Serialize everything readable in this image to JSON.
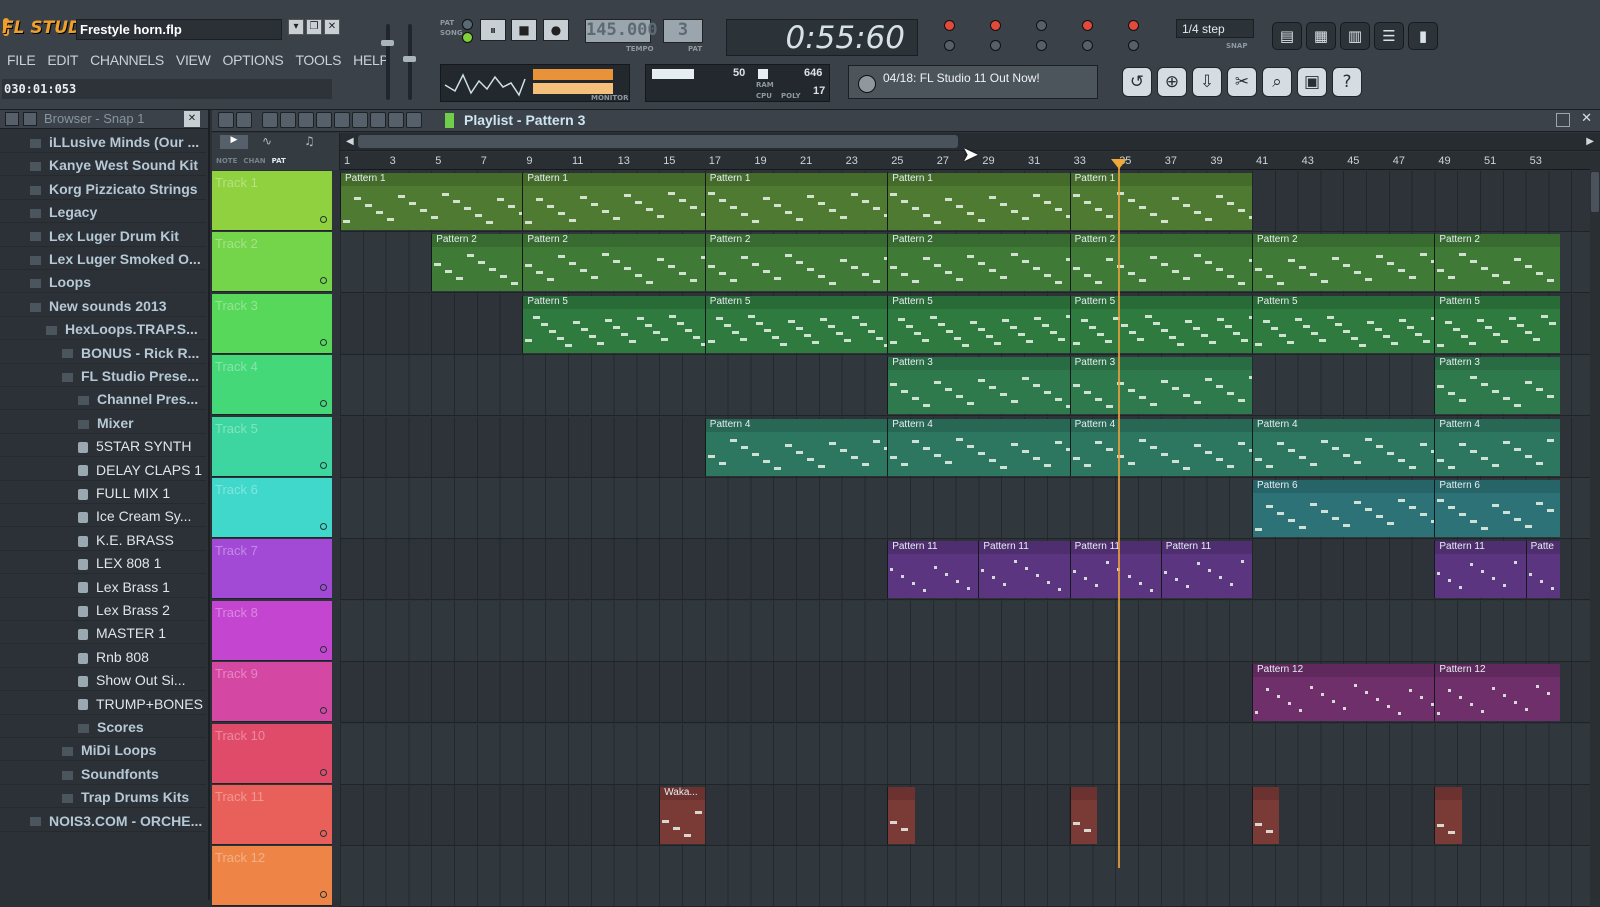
{
  "app": {
    "logo": "FL STUDIO",
    "project": "Frestyle horn.flp",
    "win_min": "▾",
    "win_max": "❐",
    "win_close": "✕"
  },
  "menu": [
    "FILE",
    "EDIT",
    "CHANNELS",
    "VIEW",
    "OPTIONS",
    "TOOLS",
    "HELP"
  ],
  "time_readout": "030:01:053",
  "transport": {
    "mode_pat": "PAT",
    "mode_song": "SONG",
    "pause": "⏸",
    "stop": "■",
    "record": "●",
    "tempo": "145.000",
    "tempo_label": "TEMPO",
    "pattern_num": "3",
    "pattern_label": "PAT",
    "clock": "0:55:60",
    "snap": "1/4 step",
    "snap_label": "SNAP"
  },
  "meters": {
    "ram": "50",
    "ram_label": "RAM",
    "cpu_label": "CPU",
    "poly": "646",
    "poly_label": "POLY",
    "voices": "17",
    "monitor": "MONITOR"
  },
  "hint": "04/18: FL Studio 11 Out Now!",
  "browser": {
    "title": "Browser - Snap 1",
    "items": [
      {
        "label": "iLLusive Minds (Our ...",
        "kind": "folder",
        "level": 0
      },
      {
        "label": "Kanye West Sound Kit",
        "kind": "folder",
        "level": 0
      },
      {
        "label": "Korg Pizzicato Strings",
        "kind": "folder",
        "level": 0
      },
      {
        "label": "Legacy",
        "kind": "folder",
        "level": 0
      },
      {
        "label": "Lex Luger Drum Kit",
        "kind": "folder",
        "level": 0
      },
      {
        "label": "Lex Luger Smoked O...",
        "kind": "folder",
        "level": 0
      },
      {
        "label": "Loops",
        "kind": "folder",
        "level": 0
      },
      {
        "label": "New sounds 2013",
        "kind": "folder",
        "level": 0
      },
      {
        "label": "HexLoops.TRAP.S...",
        "kind": "folder",
        "level": 1
      },
      {
        "label": "BONUS - Rick R...",
        "kind": "folder",
        "level": 2
      },
      {
        "label": "FL Studio Prese...",
        "kind": "folder",
        "level": 2
      },
      {
        "label": "Channel Pres...",
        "kind": "folder",
        "level": 3
      },
      {
        "label": "Mixer",
        "kind": "folder",
        "level": 3
      },
      {
        "label": "5STAR SYNTH",
        "kind": "file",
        "level": 3
      },
      {
        "label": "DELAY CLAPS 1",
        "kind": "file",
        "level": 3
      },
      {
        "label": "FULL MIX 1",
        "kind": "file",
        "level": 3
      },
      {
        "label": "Ice Cream Sy...",
        "kind": "file",
        "level": 3
      },
      {
        "label": "K.E. BRASS",
        "kind": "file",
        "level": 3
      },
      {
        "label": "LEX 808 1",
        "kind": "file",
        "level": 3
      },
      {
        "label": "Lex Brass 1",
        "kind": "file",
        "level": 3
      },
      {
        "label": "Lex Brass 2",
        "kind": "file",
        "level": 3
      },
      {
        "label": "MASTER 1",
        "kind": "file",
        "level": 3
      },
      {
        "label": "Rnb 808",
        "kind": "file",
        "level": 3
      },
      {
        "label": "Show Out Si...",
        "kind": "file",
        "level": 3
      },
      {
        "label": "TRUMP+BONES",
        "kind": "file",
        "level": 3
      },
      {
        "label": "Scores",
        "kind": "folder",
        "level": 3
      },
      {
        "label": "MiDi Loops",
        "kind": "folder",
        "level": 2
      },
      {
        "label": "Soundfonts",
        "kind": "folder",
        "level": 2
      },
      {
        "label": "Trap Drums Kits",
        "kind": "folder",
        "level": 2
      },
      {
        "label": "NOIS3.COM - ORCHE...",
        "kind": "folder",
        "level": 0
      }
    ]
  },
  "playlist": {
    "title": "Playlist - Pattern 3",
    "tool_labels": [
      "NOTE",
      "CHAN",
      "PAT"
    ],
    "bars": [
      "1",
      "3",
      "5",
      "7",
      "9",
      "11",
      "13",
      "15",
      "17",
      "19",
      "21",
      "23",
      "25",
      "27",
      "29",
      "31",
      "33",
      "35",
      "37",
      "39",
      "41",
      "43",
      "45",
      "47",
      "49",
      "51",
      "53"
    ],
    "tracks": [
      {
        "name": "Track 1",
        "color": "#8fd13f"
      },
      {
        "name": "Track 2",
        "color": "#74d44a"
      },
      {
        "name": "Track 3",
        "color": "#57d85a"
      },
      {
        "name": "Track 4",
        "color": "#45d879"
      },
      {
        "name": "Track 5",
        "color": "#3ed6a0"
      },
      {
        "name": "Track 6",
        "color": "#3fd8cb"
      },
      {
        "name": "Track 7",
        "color": "#a24ad6"
      },
      {
        "name": "Track 8",
        "color": "#c446d0"
      },
      {
        "name": "Track 9",
        "color": "#d447a2"
      },
      {
        "name": "Track 10",
        "color": "#e04b6a"
      },
      {
        "name": "Track 11",
        "color": "#e9605a"
      },
      {
        "name": "Track 12",
        "color": "#ef8447"
      }
    ],
    "clips": [
      {
        "track": 0,
        "label": "Pattern 1",
        "start": 1,
        "end": 9,
        "color": "#4f7a32"
      },
      {
        "track": 0,
        "label": "Pattern 1",
        "start": 9,
        "end": 17,
        "color": "#4f7a32"
      },
      {
        "track": 0,
        "label": "Pattern 1",
        "start": 17,
        "end": 25,
        "color": "#4f7a32"
      },
      {
        "track": 0,
        "label": "Pattern 1",
        "start": 25,
        "end": 33,
        "color": "#4f7a32"
      },
      {
        "track": 0,
        "label": "Pattern 1",
        "start": 33,
        "end": 41,
        "color": "#4f7a32"
      },
      {
        "track": 1,
        "label": "Pattern 2",
        "start": 5,
        "end": 9,
        "color": "#3f7a36"
      },
      {
        "track": 1,
        "label": "Pattern 2",
        "start": 9,
        "end": 17,
        "color": "#3f7a36"
      },
      {
        "track": 1,
        "label": "Pattern 2",
        "start": 17,
        "end": 25,
        "color": "#3f7a36"
      },
      {
        "track": 1,
        "label": "Pattern 2",
        "start": 25,
        "end": 33,
        "color": "#3f7a36"
      },
      {
        "track": 1,
        "label": "Pattern 2",
        "start": 33,
        "end": 41,
        "color": "#3f7a36"
      },
      {
        "track": 1,
        "label": "Pattern 2",
        "start": 41,
        "end": 49,
        "color": "#3f7a36"
      },
      {
        "track": 1,
        "label": "Pattern 2",
        "start": 49,
        "end": 54.5,
        "color": "#3f7a36"
      },
      {
        "track": 2,
        "label": "Pattern 5",
        "start": 9,
        "end": 17,
        "color": "#2f7a3f"
      },
      {
        "track": 2,
        "label": "Pattern 5",
        "start": 17,
        "end": 25,
        "color": "#2f7a3f"
      },
      {
        "track": 2,
        "label": "Pattern 5",
        "start": 25,
        "end": 33,
        "color": "#2f7a3f"
      },
      {
        "track": 2,
        "label": "Pattern 5",
        "start": 33,
        "end": 41,
        "color": "#2f7a3f"
      },
      {
        "track": 2,
        "label": "Pattern 5",
        "start": 41,
        "end": 49,
        "color": "#2f7a3f"
      },
      {
        "track": 2,
        "label": "Pattern 5",
        "start": 49,
        "end": 54.5,
        "color": "#2f7a3f"
      },
      {
        "track": 3,
        "label": "Pattern 3",
        "start": 25,
        "end": 33,
        "color": "#2f7a4c"
      },
      {
        "track": 3,
        "label": "Pattern 3",
        "start": 33,
        "end": 41,
        "color": "#2f7a4c"
      },
      {
        "track": 3,
        "label": "Pattern 3",
        "start": 49,
        "end": 54.5,
        "color": "#2f7a4c"
      },
      {
        "track": 4,
        "label": "Pattern 4",
        "start": 17,
        "end": 25,
        "color": "#2d7660"
      },
      {
        "track": 4,
        "label": "Pattern 4",
        "start": 25,
        "end": 33,
        "color": "#2d7660"
      },
      {
        "track": 4,
        "label": "Pattern 4",
        "start": 33,
        "end": 41,
        "color": "#2d7660"
      },
      {
        "track": 4,
        "label": "Pattern 4",
        "start": 41,
        "end": 49,
        "color": "#2d7660"
      },
      {
        "track": 4,
        "label": "Pattern 4",
        "start": 49,
        "end": 54.5,
        "color": "#2d7660"
      },
      {
        "track": 5,
        "label": "Pattern 6",
        "start": 41,
        "end": 49,
        "color": "#2d7276"
      },
      {
        "track": 5,
        "label": "Pattern 6",
        "start": 49,
        "end": 54.5,
        "color": "#2d7276"
      },
      {
        "track": 6,
        "label": "Pattern 11",
        "start": 25,
        "end": 29,
        "color": "#5b3580"
      },
      {
        "track": 6,
        "label": "Pattern 11",
        "start": 29,
        "end": 33,
        "color": "#5b3580"
      },
      {
        "track": 6,
        "label": "Pattern 11",
        "start": 33,
        "end": 37,
        "color": "#5b3580"
      },
      {
        "track": 6,
        "label": "Pattern 11",
        "start": 37,
        "end": 41,
        "color": "#5b3580"
      },
      {
        "track": 6,
        "label": "Pattern 11",
        "start": 49,
        "end": 53,
        "color": "#5b3580"
      },
      {
        "track": 6,
        "label": "Patte",
        "start": 53,
        "end": 54.5,
        "color": "#5b3580"
      },
      {
        "track": 8,
        "label": "Pattern 12",
        "start": 41,
        "end": 49,
        "color": "#6e2f6a"
      },
      {
        "track": 8,
        "label": "Pattern 12",
        "start": 49,
        "end": 54.5,
        "color": "#6e2f6a"
      },
      {
        "track": 10,
        "label": "Waka...",
        "start": 15,
        "end": 17,
        "color": "#7a3a36"
      },
      {
        "track": 10,
        "label": "",
        "start": 25,
        "end": 26.2,
        "color": "#7a3a36"
      },
      {
        "track": 10,
        "label": "",
        "start": 33,
        "end": 34.2,
        "color": "#7a3a36"
      },
      {
        "track": 10,
        "label": "",
        "start": 41,
        "end": 42.2,
        "color": "#7a3a36"
      },
      {
        "track": 10,
        "label": "",
        "start": 49,
        "end": 50.2,
        "color": "#7a3a36"
      }
    ]
  }
}
